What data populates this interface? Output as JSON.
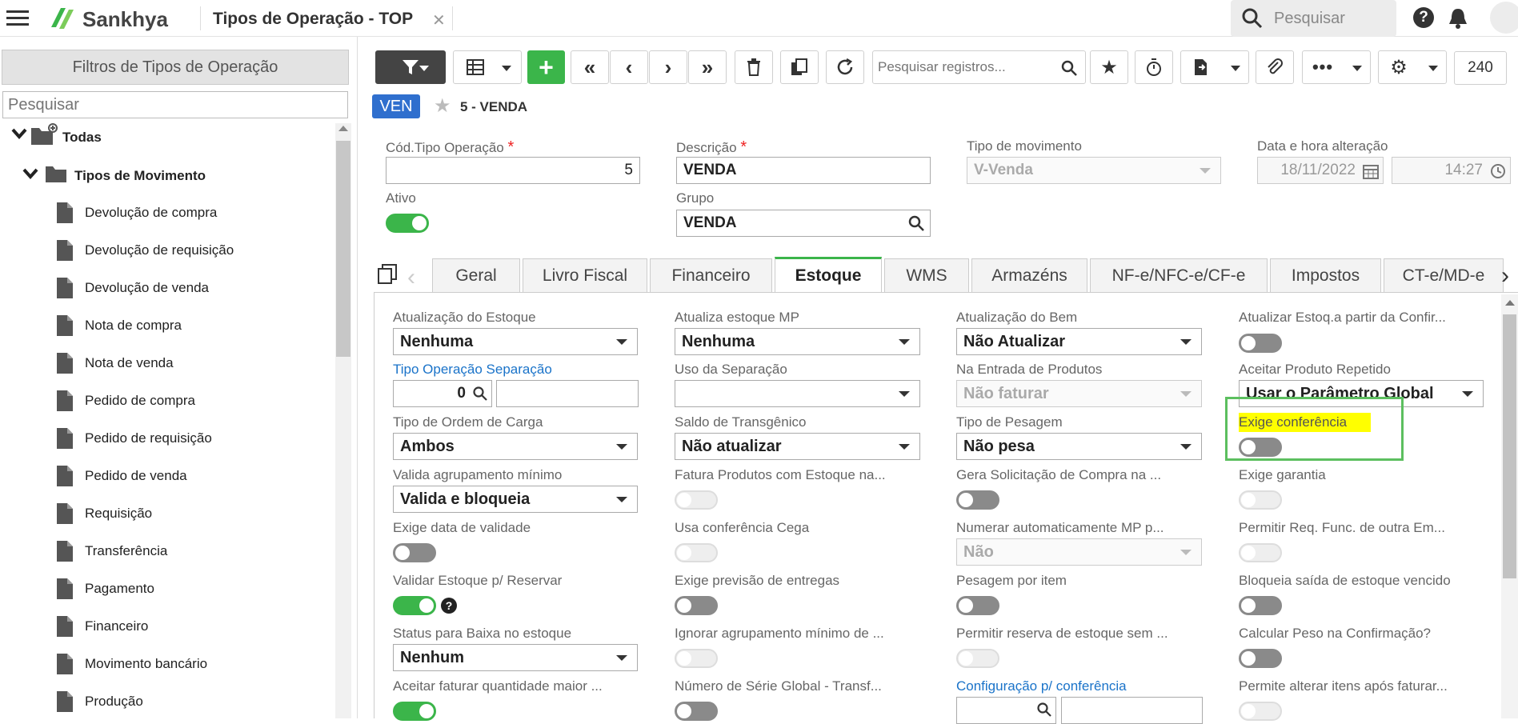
{
  "app": {
    "brand": "Sankhya",
    "tab_title": "Tipos de Operação - TOP",
    "search_placeholder": "Pesquisar"
  },
  "sidebar": {
    "title": "Filtros de Tipos de Operação",
    "search_placeholder": "Pesquisar",
    "root": "Todas",
    "group": "Tipos de Movimento",
    "items": [
      "Devolução de compra",
      "Devolução de requisição",
      "Devolução de venda",
      "Nota de compra",
      "Nota de venda",
      "Pedido de compra",
      "Pedido de requisição",
      "Pedido de venda",
      "Requisição",
      "Transferência",
      "Pagamento",
      "Financeiro",
      "Movimento bancário",
      "Produção"
    ]
  },
  "toolbar": {
    "search_placeholder": "Pesquisar registros...",
    "count": "240"
  },
  "record": {
    "badge": "VEN",
    "title": "5 - VENDA"
  },
  "header_fields": {
    "cod_label": "Cód.Tipo Operação",
    "cod_value": "5",
    "desc_label": "Descrição",
    "desc_value": "VENDA",
    "tipo_mov_label": "Tipo de movimento",
    "tipo_mov_value": "V-Venda",
    "data_label": "Data e hora alteração",
    "data_value": "18/11/2022",
    "hora_value": "14:27",
    "ativo_label": "Ativo",
    "grupo_label": "Grupo",
    "grupo_value": "VENDA",
    "required_mark": "*"
  },
  "tabs": [
    "Geral",
    "Livro Fiscal",
    "Financeiro",
    "Estoque",
    "WMS",
    "Armazéns",
    "NF-e/NFC-e/CF-e",
    "Impostos",
    "CT-e/MD-e"
  ],
  "active_tab": "Estoque",
  "estoque": {
    "atualizacao_estoque": {
      "label": "Atualização do Estoque",
      "value": "Nenhuma"
    },
    "atualiza_estoque_mp": {
      "label": "Atualiza estoque MP",
      "value": "Nenhuma"
    },
    "atualizacao_bem": {
      "label": "Atualização do Bem",
      "value": "Não Atualizar"
    },
    "atualizar_estoq_confir": {
      "label": "Atualizar Estoq.a partir da Confir..."
    },
    "tipo_op_separacao": {
      "label": "Tipo Operação Separação",
      "value": "0"
    },
    "uso_separacao": {
      "label": "Uso da Separação",
      "value": ""
    },
    "na_entrada_produtos": {
      "label": "Na Entrada de Produtos",
      "value": "Não faturar"
    },
    "aceitar_produto_repetido": {
      "label": "Aceitar Produto Repetido",
      "value": "Usar o Parâmetro Global"
    },
    "tipo_ordem_carga": {
      "label": "Tipo de Ordem de Carga",
      "value": "Ambos"
    },
    "saldo_transgenico": {
      "label": "Saldo de Transgênico",
      "value": "Não atualizar"
    },
    "tipo_pesagem": {
      "label": "Tipo de Pesagem",
      "value": "Não pesa"
    },
    "exige_conferencia": {
      "label": "Exige conferência"
    },
    "valida_agrupamento": {
      "label": "Valida agrupamento mínimo",
      "value": "Valida e bloqueia"
    },
    "fatura_produtos_estoque": {
      "label": "Fatura Produtos com Estoque na..."
    },
    "gera_solicitacao_compra": {
      "label": "Gera Solicitação de Compra na ..."
    },
    "exige_garantia": {
      "label": "Exige garantia"
    },
    "exige_data_validade": {
      "label": "Exige data de validade"
    },
    "usa_conferencia_cega": {
      "label": "Usa conferência Cega"
    },
    "numerar_auto_mp": {
      "label": "Numerar automaticamente MP p...",
      "value": "Não"
    },
    "permitir_req_func": {
      "label": "Permitir Req. Func. de outra Em..."
    },
    "validar_estoque_reservar": {
      "label": "Validar Estoque p/ Reservar",
      "help": "?"
    },
    "exige_previsao_entregas": {
      "label": "Exige previsão de entregas"
    },
    "pesagem_por_item": {
      "label": "Pesagem por item"
    },
    "bloqueia_saida_vencido": {
      "label": "Bloqueia saída de estoque vencido"
    },
    "status_baixa_estoque": {
      "label": "Status para Baixa no estoque",
      "value": "Nenhum"
    },
    "ignorar_agrupamento": {
      "label": "Ignorar agrupamento mínimo de ..."
    },
    "permitir_reserva_sem": {
      "label": "Permitir reserva de estoque sem ..."
    },
    "calcular_peso_confirmacao": {
      "label": "Calcular Peso na Confirmação?"
    },
    "aceitar_faturar_qtd": {
      "label": "Aceitar faturar quantidade maior ..."
    },
    "numero_serie_global": {
      "label": "Número de Série Global - Transf..."
    },
    "config_conferencia": {
      "label": "Configuração p/ conferência"
    },
    "permite_alterar_itens": {
      "label": "Permite alterar itens após faturar..."
    }
  },
  "colors": {
    "accent_green": "#3bb54a",
    "badge_blue": "#2f6fce",
    "highlight_yellow": "#ffff00",
    "link_blue": "#1a73c9"
  }
}
